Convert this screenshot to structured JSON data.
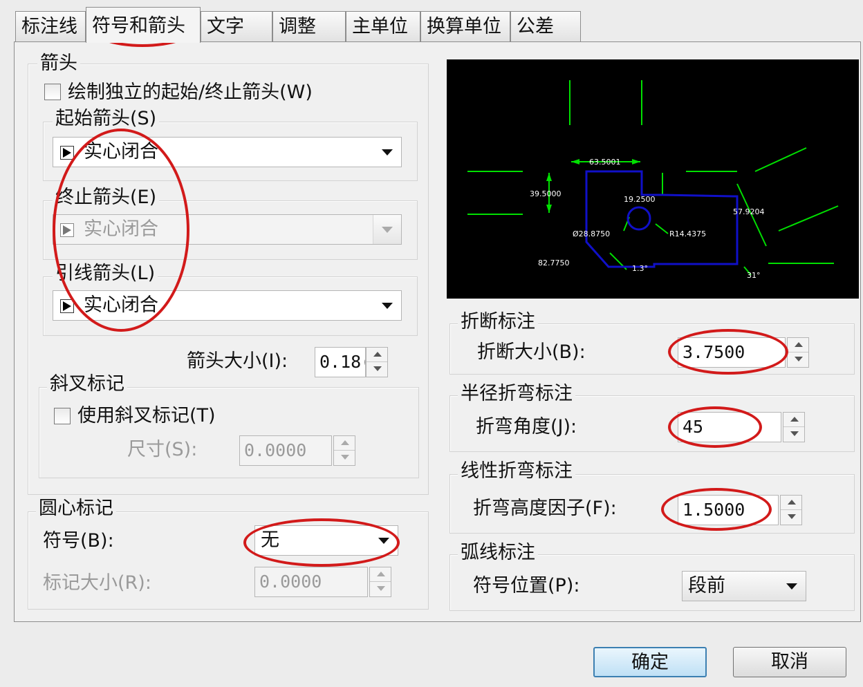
{
  "tabs": [
    {
      "label": "标注线"
    },
    {
      "label": "符号和箭头"
    },
    {
      "label": "文字"
    },
    {
      "label": "调整"
    },
    {
      "label": "主单位"
    },
    {
      "label": "换算单位"
    },
    {
      "label": "公差"
    }
  ],
  "arrows": {
    "group_title": "箭头",
    "independent_checkbox_label": "绘制独立的起始/终止箭头(W)",
    "independent_checked": false,
    "first_label": "起始箭头(S)",
    "first_value": "实心闭合",
    "second_label": "终止箭头(E)",
    "second_value": "实心闭合",
    "leader_label": "引线箭头(L)",
    "leader_value": "实心闭合",
    "size_label": "箭头大小(I):",
    "size_value": "0.18("
  },
  "tick": {
    "group_title": "斜叉标记",
    "checkbox_label": "使用斜叉标记(T)",
    "checked": false,
    "size_label": "尺寸(S):",
    "size_value": "0.0000"
  },
  "center": {
    "group_title": "圆心标记",
    "symbol_label": "符号(B):",
    "symbol_value": "无",
    "size_label": "标记大小(R):",
    "size_value": "0.0000"
  },
  "preview": {
    "labels": [
      "63.5001",
      "39.5000",
      "19.2500",
      "57.9204",
      "Ø28.8750",
      "R14.4375",
      "82.7750",
      "1.3°",
      "31°"
    ],
    "line_color": "#00e000",
    "dim_text_color": "#ffffff",
    "object_color": "#1010c8"
  },
  "break": {
    "group_title": "折断标注",
    "size_label": "折断大小(B):",
    "size_value": "3.7500"
  },
  "radius_jog": {
    "group_title": "半径折弯标注",
    "angle_label": "折弯角度(J):",
    "angle_value": "45"
  },
  "linear_jog": {
    "group_title": "线性折弯标注",
    "factor_label": "折弯高度因子(F):",
    "factor_value": "1.5000"
  },
  "arc": {
    "group_title": "弧线标注",
    "position_label": "符号位置(P):",
    "position_value": "段前"
  },
  "buttons": {
    "ok": "确定",
    "cancel": "取消"
  },
  "annotation_color": "#d21a1a"
}
